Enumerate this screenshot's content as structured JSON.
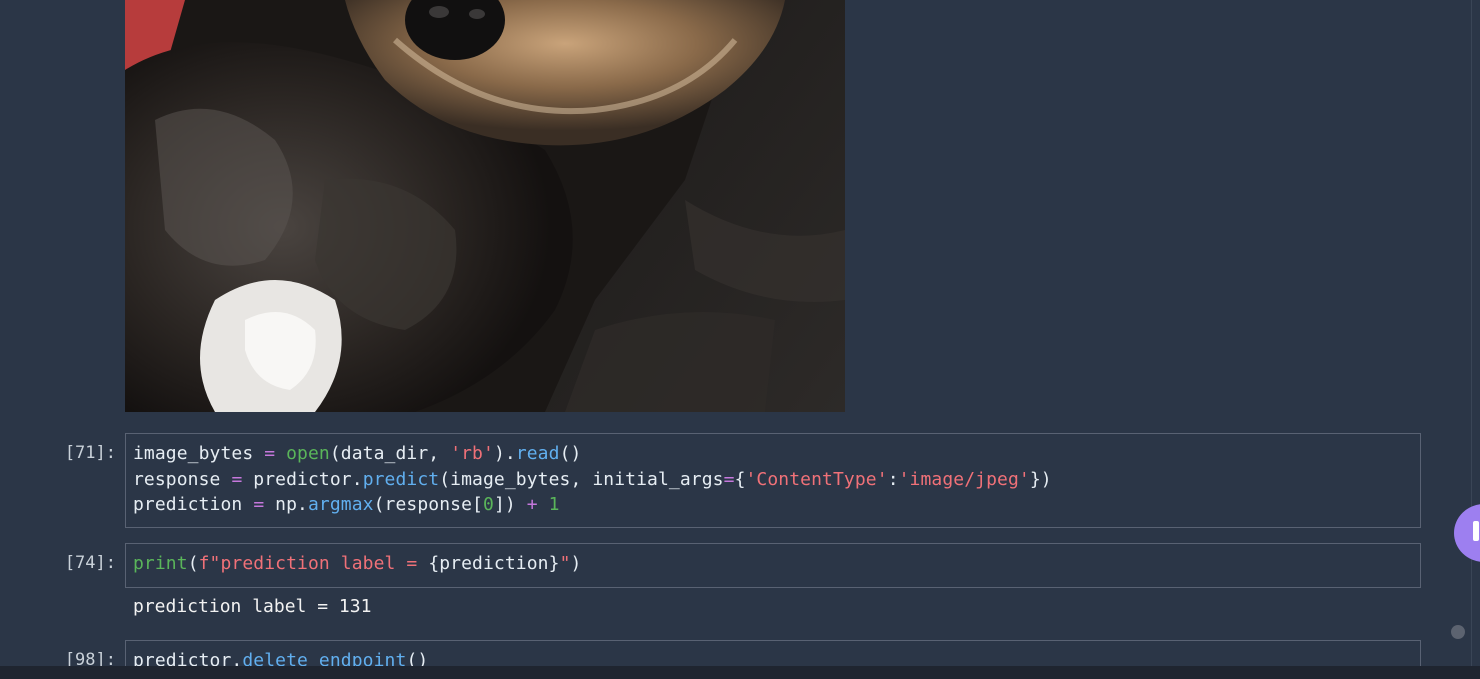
{
  "cells": [
    {
      "prompt": "[71]:",
      "lines": [
        [
          {
            "t": "image_bytes ",
            "c": "var"
          },
          {
            "t": "=",
            "c": "op"
          },
          {
            "t": " ",
            "c": "var"
          },
          {
            "t": "open",
            "c": "builtin"
          },
          {
            "t": "(data_dir, ",
            "c": "punct"
          },
          {
            "t": "'rb'",
            "c": "str"
          },
          {
            "t": ").",
            "c": "punct"
          },
          {
            "t": "read",
            "c": "method"
          },
          {
            "t": "()",
            "c": "punct"
          }
        ],
        [
          {
            "t": "response ",
            "c": "var"
          },
          {
            "t": "=",
            "c": "op"
          },
          {
            "t": " predictor.",
            "c": "var"
          },
          {
            "t": "predict",
            "c": "method"
          },
          {
            "t": "(image_bytes, initial_args",
            "c": "punct"
          },
          {
            "t": "=",
            "c": "op"
          },
          {
            "t": "{",
            "c": "punct"
          },
          {
            "t": "'ContentType'",
            "c": "str"
          },
          {
            "t": ":",
            "c": "punct"
          },
          {
            "t": "'image/jpeg'",
            "c": "str"
          },
          {
            "t": "})",
            "c": "punct"
          }
        ],
        [
          {
            "t": "prediction ",
            "c": "var"
          },
          {
            "t": "=",
            "c": "op"
          },
          {
            "t": " np.",
            "c": "var"
          },
          {
            "t": "argmax",
            "c": "method"
          },
          {
            "t": "(response[",
            "c": "punct"
          },
          {
            "t": "0",
            "c": "num"
          },
          {
            "t": "]) ",
            "c": "punct"
          },
          {
            "t": "+",
            "c": "op"
          },
          {
            "t": " ",
            "c": "var"
          },
          {
            "t": "1",
            "c": "num"
          }
        ]
      ]
    },
    {
      "prompt": "[74]:",
      "lines": [
        [
          {
            "t": "print",
            "c": "builtin"
          },
          {
            "t": "(",
            "c": "punct"
          },
          {
            "t": "f\"prediction label = ",
            "c": "str"
          },
          {
            "t": "{prediction}",
            "c": "var"
          },
          {
            "t": "\"",
            "c": "str"
          },
          {
            "t": ")",
            "c": "punct"
          }
        ]
      ],
      "output": "prediction label = 131"
    },
    {
      "prompt": "[98]:",
      "lines": [
        [
          {
            "t": "predictor.",
            "c": "var"
          },
          {
            "t": "delete_endpoint",
            "c": "method"
          },
          {
            "t": "()",
            "c": "punct"
          }
        ]
      ]
    }
  ],
  "image_output": {
    "icon": "dog-photo"
  },
  "colors": {
    "background": "#2b3647",
    "cell_border": "#596273",
    "operator": "#c678dd",
    "builtin": "#5ab55a",
    "string": "#f07178",
    "method": "#61afef",
    "chat_bubble": "#9d7ff0"
  }
}
